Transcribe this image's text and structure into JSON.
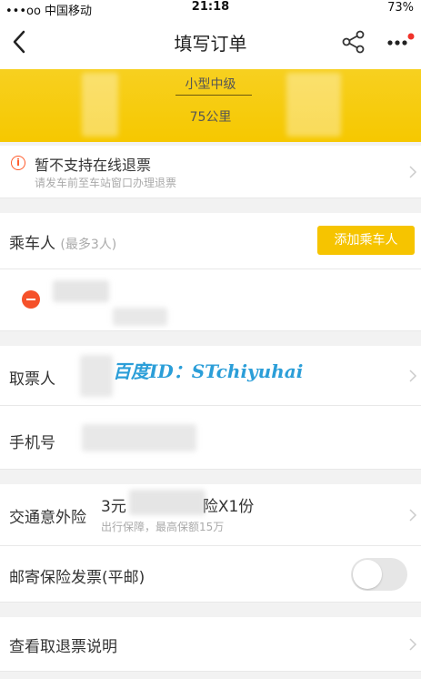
{
  "status_bar": {
    "carrier": "•••oo 中国移动",
    "time": "21:18",
    "battery": "73%"
  },
  "nav": {
    "title": "填写订单",
    "back_icon": "chevron-left-icon",
    "share_icon": "share-icon",
    "more_icon": "more-icon"
  },
  "trip": {
    "bus_type": "小型中级",
    "distance": "75公里"
  },
  "refund": {
    "title": "暂不支持在线退票",
    "subtitle": "请发车前至车站窗口办理退票"
  },
  "passengers": {
    "label": "乘车人",
    "hint": "(最多3人)",
    "add_button": "添加乘车人"
  },
  "ticket_taker": {
    "label": "取票人"
  },
  "phone": {
    "label": "手机号"
  },
  "watermark": "百度ID：STchiyuhai",
  "insurance": {
    "label": "交通意外险",
    "value_prefix": "3元",
    "value_suffix": "险X1份",
    "subtitle": "出行保障，最高保额15万"
  },
  "invoice": {
    "label": "邮寄保险发票(平邮)",
    "enabled": false
  },
  "rules": {
    "label": "查看取退票说明"
  },
  "colors": {
    "accent": "#f6c400",
    "warning": "#ff5a2a",
    "watermark": "#2b9ed8"
  }
}
